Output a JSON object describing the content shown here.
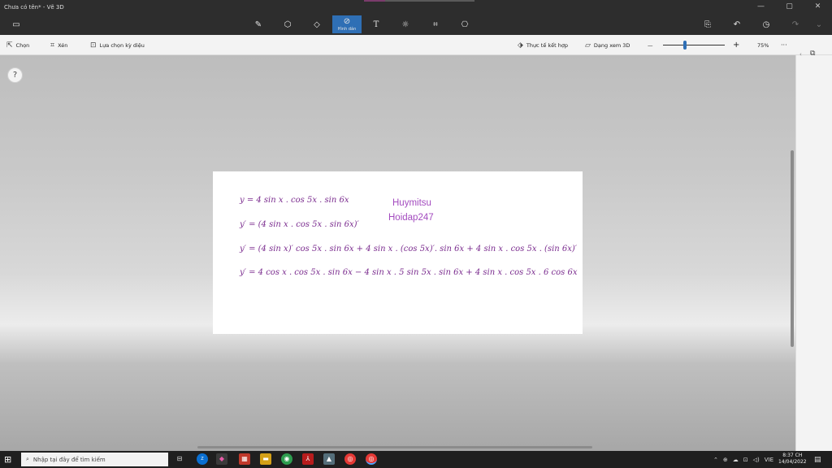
{
  "window": {
    "title": "Chưa có tên* - Vẽ 3D"
  },
  "window_controls": {
    "minimize": "—",
    "maximize": "▢",
    "close": "✕"
  },
  "toolbar": {
    "active_label": "Hình dán",
    "icons": [
      "menu-icon",
      "brush-icon",
      "shapes-2d-icon",
      "shapes-3d-icon",
      "stickers-icon",
      "text-icon",
      "effects-icon",
      "canvas-icon",
      "library-3d-icon",
      "paste-icon",
      "undo-icon",
      "history-icon",
      "redo-icon"
    ]
  },
  "subbar": {
    "select": "Chọn",
    "crop": "Xén",
    "magic_select": "Lựa chọn kỳ diệu",
    "mixed_reality": "Thực tế kết hợp",
    "view_3d": "Dạng xem 3D",
    "zoom_minus": "—",
    "zoom_plus": "+",
    "zoom_level": "75%",
    "more": "···",
    "zoom_fraction": 0.36
  },
  "help": "?",
  "document": {
    "equations": [
      "y = 4 sin x . cos 5x . sin 6x",
      "y′ = (4 sin x . cos 5x . sin 6x)′",
      "y′ = (4 sin x)′ cos 5x . sin 6x + 4 sin x . (cos 5x)′. sin 6x + 4 sin x . cos 5x . (sin 6x)′",
      "y′ = 4 cos x . cos 5x . sin 6x − 4 sin x . 5 sin 5x . sin 6x + 4 sin x . cos 5x . 6 cos 6x"
    ],
    "watermark_line1": "Huymitsu",
    "watermark_line2": "Hoidap247"
  },
  "taskbar": {
    "search_placeholder": "Nhập tại đây để tìm kiếm",
    "language": "VIE",
    "time": "8:37 CH",
    "date": "14/04/2022"
  }
}
